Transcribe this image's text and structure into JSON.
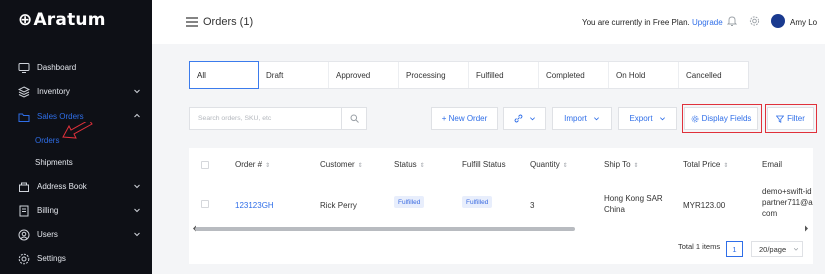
{
  "brand": {
    "logo_mark": "⊕",
    "logo_text": "Aratum"
  },
  "sidebar": {
    "items": [
      {
        "label": "Dashboard",
        "icon": "dashboard-icon",
        "chevron": false
      },
      {
        "label": "Inventory",
        "icon": "inventory-icon",
        "chevron": true
      },
      {
        "label": "Sales Orders",
        "icon": "sales-orders-icon",
        "chevron": true,
        "active": true
      },
      {
        "label": "Address Book",
        "icon": "address-book-icon",
        "chevron": true
      },
      {
        "label": "Billing",
        "icon": "billing-icon",
        "chevron": true
      },
      {
        "label": "Users",
        "icon": "users-icon",
        "chevron": true
      },
      {
        "label": "Settings",
        "icon": "settings-icon",
        "chevron": false
      }
    ],
    "sub_items": [
      {
        "label": "Orders",
        "active": true
      },
      {
        "label": "Shipments",
        "active": false
      }
    ]
  },
  "header": {
    "title": "Orders (1)",
    "plan_text": "You are currently in Free Plan.",
    "upgrade_label": "Upgrade",
    "user_name": "Amy Lo"
  },
  "tabs": [
    "All",
    "Draft",
    "Approved",
    "Processing",
    "Fulfilled",
    "Completed",
    "On Hold",
    "Cancelled"
  ],
  "toolbar": {
    "search_placeholder": "Search orders, SKU, etc",
    "new_order_label": "+ New Order",
    "import_label": "Import",
    "export_label": "Export",
    "display_fields_label": "Display Fields",
    "filter_label": "Filter"
  },
  "table": {
    "columns": [
      "Order #",
      "Customer",
      "Status",
      "Fulfill Status",
      "Quantity",
      "Ship To",
      "Total Price",
      "Email"
    ],
    "rows": [
      {
        "order": "123123GH",
        "customer": "Rick Perry",
        "status": "Fulfilled",
        "fulfill_status": "Fulfilled",
        "quantity": "3",
        "ship_to_1": "Hong Kong SAR",
        "ship_to_2": "China",
        "total_price": "MYR123.00",
        "email_1": "demo+swift-id",
        "email_2": "partner711@a",
        "email_3": "com"
      }
    ]
  },
  "pagination": {
    "total_label": "Total 1 items",
    "page": "1",
    "page_size": "20/page"
  },
  "colors": {
    "accent": "#2f6ee8",
    "sidebar_bg": "#0e1016",
    "highlight": "#e0313b"
  }
}
